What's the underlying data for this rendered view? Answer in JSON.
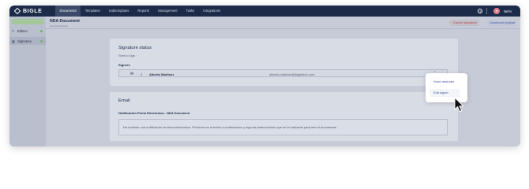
{
  "app": {
    "logo_text": "BIGLE"
  },
  "nav": [
    {
      "label": "Documents",
      "active": true
    },
    {
      "label": "Templates"
    },
    {
      "label": "Subtemplates"
    },
    {
      "label": "Reports"
    },
    {
      "label": "Management"
    },
    {
      "label": "Tasks"
    },
    {
      "label": "Integrations"
    }
  ],
  "user": {
    "initials": "B",
    "name": "Behn"
  },
  "sidebar": {
    "top_button": "",
    "items": [
      {
        "label": "Edition",
        "icon": "edit-icon",
        "dot_color": "#6fb56d"
      },
      {
        "label": "Signature",
        "icon": "signature-icon",
        "dot_color": "#6fb56d",
        "selected": true
      }
    ]
  },
  "header": {
    "title": "NDA Document",
    "subtitle": "Internal Document",
    "cancel_label": "Cancel signature",
    "download_label": "Download original"
  },
  "signature": {
    "title": "Signature status",
    "status": "Sent to sign",
    "signers_label": "Signers",
    "signers": [
      {
        "number": "1",
        "name": "Alberto Martinez",
        "email": "alberto.martinez@bigletech.com"
      }
    ]
  },
  "email": {
    "title": "Email",
    "notification_title": "Notificación Firma Electrónica - NDA Document",
    "message": "Ha recibido una notificación de firma electrónica. Presione en el botón a continuación y siga las instrucciones que se le indicarán para leer el documento."
  },
  "menu": {
    "send_reminder": "Send reminder",
    "edit_signer": "Edit signer"
  },
  "colors": {
    "topbar": "#1b2b48",
    "accent": "#3f5aa6",
    "danger": "#b84555",
    "warning": "#c9a13e",
    "success": "#6fb56d"
  }
}
